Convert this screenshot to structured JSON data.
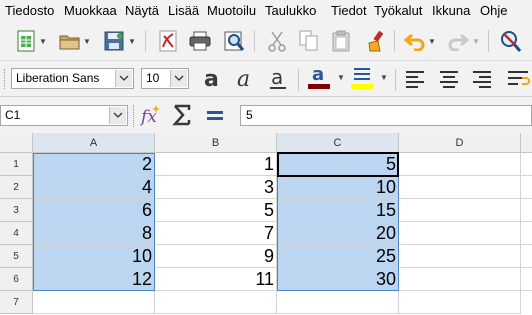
{
  "menu": [
    "Tiedosto",
    "Muokkaa",
    "Näytä",
    "Lisää",
    "Muotoilu",
    "Taulukko",
    "Tiedot",
    "Työkalut",
    "Ikkuna",
    "Ohje"
  ],
  "toolbar": {
    "font_name": "Liberation Sans",
    "font_size": "10",
    "icons": [
      "new-spreadsheet-icon",
      "open-folder-icon",
      "save-icon",
      "export-pdf-icon",
      "print-icon",
      "print-preview-icon",
      "cut-icon",
      "copy-icon",
      "paste-icon",
      "clone-formatting-icon",
      "undo-icon",
      "redo-icon",
      "find-replace-icon"
    ],
    "format_icons": [
      "bold-icon",
      "italic-icon",
      "underline-icon",
      "font-color-icon",
      "highlight-color-icon",
      "align-left-icon",
      "align-center-icon",
      "align-right-icon",
      "wrap-text-icon"
    ],
    "font_color": "#800000",
    "highlight_color": "#ffff00"
  },
  "formula_bar": {
    "name_box": "C1",
    "content": "5"
  },
  "grid": {
    "columns": [
      "A",
      "B",
      "C",
      "D"
    ],
    "rows": [
      {
        "num": "1",
        "cells": [
          "2",
          "1",
          "5",
          ""
        ]
      },
      {
        "num": "2",
        "cells": [
          "4",
          "3",
          "10",
          ""
        ]
      },
      {
        "num": "3",
        "cells": [
          "6",
          "5",
          "15",
          ""
        ]
      },
      {
        "num": "4",
        "cells": [
          "8",
          "7",
          "20",
          ""
        ]
      },
      {
        "num": "5",
        "cells": [
          "10",
          "9",
          "25",
          ""
        ]
      },
      {
        "num": "6",
        "cells": [
          "12",
          "11",
          "30",
          ""
        ]
      },
      {
        "num": "7",
        "cells": [
          "",
          "",
          "",
          ""
        ]
      }
    ],
    "selection_color": "#bcd6f1",
    "cursor_color": "#000000"
  }
}
